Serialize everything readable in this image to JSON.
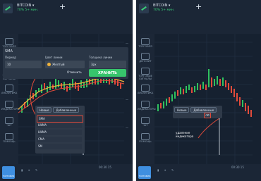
{
  "left": {
    "asset": "BITCOIN ▾",
    "return": "70% 5+ мин.",
    "time_labels": [
      "00:30 15"
    ],
    "annotation": "установленные\nскользящие средние",
    "dialog": {
      "title": "SMA",
      "period_label": "Период",
      "period_value": "10",
      "color_label": "Цвет линии",
      "color_value": "Желтый",
      "thickness_label": "Толщина линии",
      "thickness_value": "3px",
      "cancel_label": "Отменить",
      "save_label": "ХРАНИТЬ"
    },
    "menu": {
      "tabs": [
        "Новые",
        "Добавленные"
      ],
      "items": [
        "SMA",
        "LWMA",
        "LWMA",
        "CMA",
        "SM"
      ]
    }
  },
  "right": {
    "asset": "BITCOIN ▾",
    "return": "70% 5+ мин.",
    "time_labels": [
      "00:30 15"
    ],
    "annotation": "удаление\nиндикатора",
    "menu": {
      "tabs": [
        "Новые",
        "Добавленные"
      ]
    }
  },
  "sidebar_labels": [
    "ТОРГОВЛЯ",
    "ДЕПОЗИТ",
    "ТОРГОВЫЕ\nСИГНАЛЫ",
    "АНАЛИТИКА",
    "ИНДИКАТОРЫ",
    "ЧАТ",
    "ПОМОЩЬ"
  ],
  "bottom_label": "ТОРГОВЛЯ"
}
